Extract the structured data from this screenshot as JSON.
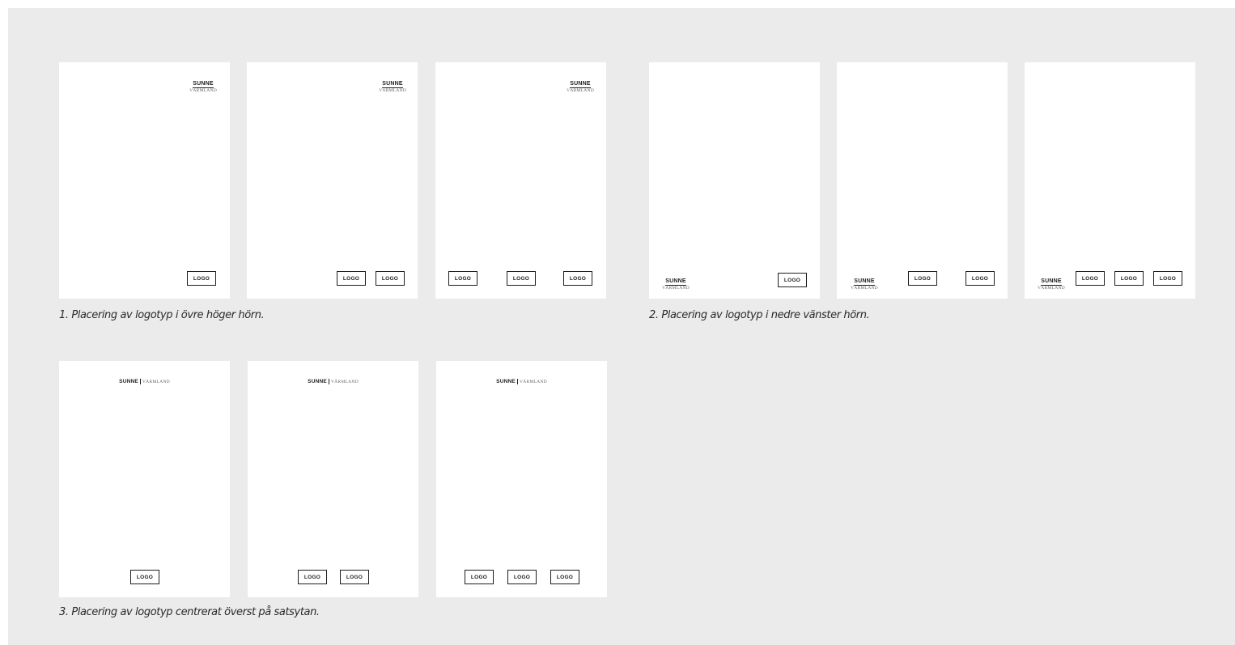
{
  "brand": {
    "top": "SUNNE",
    "bottom": "VÄRMLAND"
  },
  "logo_label": "LOGO",
  "sections": [
    {
      "caption": "1. Placering av logotyp i övre höger hörn."
    },
    {
      "caption": "2. Placering av logotyp i nedre vänster hörn."
    },
    {
      "caption": "3. Placering av logotyp centrerat överst på satsytan."
    }
  ]
}
